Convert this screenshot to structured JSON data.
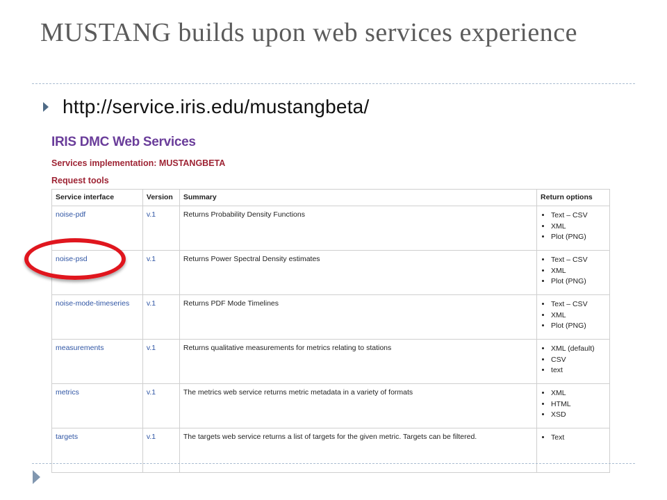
{
  "slide": {
    "title": "MUSTANG builds upon web services experience",
    "bullet": "http://service.iris.edu/mustangbeta/"
  },
  "page": {
    "site_title": "IRIS DMC Web Services",
    "implementation_heading": "Services implementation: MUSTANGBETA",
    "tools_heading": "Request tools"
  },
  "table": {
    "headers": [
      "Service interface",
      "Version",
      "Summary",
      "Return options"
    ],
    "rows": [
      {
        "service": "noise-pdf",
        "version": "v.1",
        "summary": "Returns Probability Density Functions",
        "options": [
          "Text – CSV",
          "XML",
          "Plot (PNG)"
        ]
      },
      {
        "service": "noise-psd",
        "version": "v.1",
        "summary": "Returns Power Spectral Density estimates",
        "options": [
          "Text – CSV",
          "XML",
          "Plot (PNG)"
        ]
      },
      {
        "service": "noise-mode-timeseries",
        "version": "v.1",
        "summary": "Returns PDF Mode Timelines",
        "options": [
          "Text – CSV",
          "XML",
          "Plot (PNG)"
        ]
      },
      {
        "service": "measurements",
        "version": "v.1",
        "summary": "Returns qualitative measurements for metrics relating to stations",
        "options": [
          "XML (default)",
          "CSV",
          "text"
        ]
      },
      {
        "service": "metrics",
        "version": "v.1",
        "summary": "The metrics web service returns metric metadata in a variety of formats",
        "options": [
          "XML",
          "HTML",
          "XSD"
        ]
      },
      {
        "service": "targets",
        "version": "v.1",
        "summary": "The targets web service returns a list of targets for the given metric. Targets can be filtered.",
        "options": [
          "Text"
        ]
      }
    ]
  },
  "colors": {
    "title_text": "#5b5b5b",
    "site_title": "#6a3d9a",
    "section_heading": "#9e2434",
    "link": "#2f55a4",
    "highlight_ring": "#e0161e",
    "dashed_rule": "#a9bcd0",
    "bullet": "#4f6b86"
  },
  "icons": {
    "bullet": "triangle-right-icon",
    "corner": "triangle-right-icon"
  }
}
